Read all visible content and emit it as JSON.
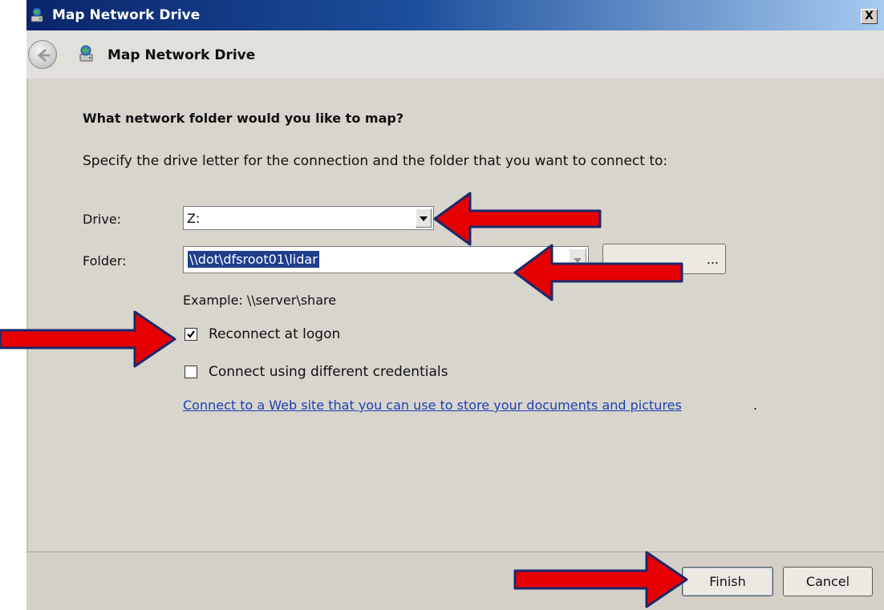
{
  "window": {
    "title": "Map Network Drive",
    "close_glyph": "X"
  },
  "nav": {
    "title": "Map Network Drive"
  },
  "content": {
    "heading": "What network folder would you like to map?",
    "description": "Specify the drive letter for the connection and the folder that you want to connect to:",
    "drive": {
      "label": "Drive:",
      "value": "Z:"
    },
    "folder": {
      "label": "Folder:",
      "value": "\\\\dot\\dfsroot01\\lidar",
      "browse_label": "..."
    },
    "example": "Example: \\\\server\\share",
    "reconnect": {
      "label": "Reconnect at logon",
      "checked": true
    },
    "different_credentials": {
      "label": "Connect using different credentials",
      "checked": false
    },
    "web_link": {
      "text": "Connect to a Web site that you can use to store your documents and pictures",
      "trailing": "."
    }
  },
  "footer": {
    "finish_label": "Finish",
    "cancel_label": "Cancel"
  },
  "icons": {
    "title_icon": "network-drive-icon",
    "nav_icon": "network-drive-icon",
    "back": "back-arrow-icon",
    "annotation_arrow": "red-arrow-icon"
  },
  "colors": {
    "titlebar_start": "#0a246a",
    "titlebar_end": "#a6caf0",
    "dialog_bg": "#d4d0c8",
    "selection": "#1f3e8c",
    "link": "#1f3fb3",
    "annotation_arrow": "#e60000"
  }
}
